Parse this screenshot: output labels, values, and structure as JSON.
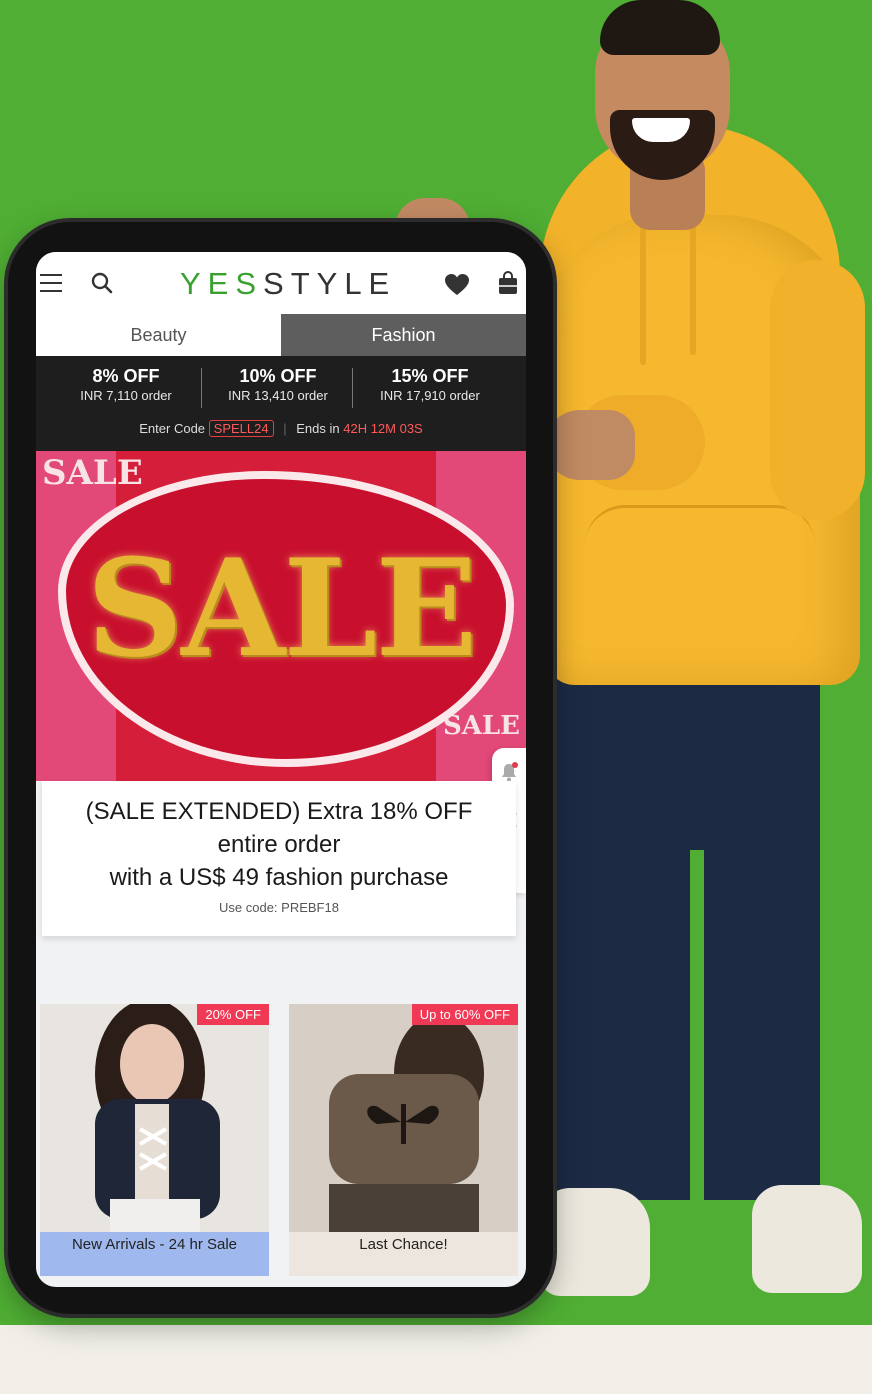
{
  "app": {
    "logo_prefix": "YES",
    "logo_suffix": "STYLE",
    "brand_green": "#3aa12f"
  },
  "header": {
    "icons": [
      "menu-icon",
      "search-icon",
      "heart-icon",
      "shopping-bag-icon"
    ]
  },
  "tabs": [
    {
      "label": "Beauty",
      "active": false
    },
    {
      "label": "Fashion",
      "active": true
    }
  ],
  "promo": {
    "tiers": [
      {
        "discount": "8% OFF",
        "threshold": "INR 7,110 order"
      },
      {
        "discount": "10% OFF",
        "threshold": "INR 13,410 order"
      },
      {
        "discount": "15% OFF",
        "threshold": "INR 17,910 order"
      }
    ],
    "enter_code_label": "Enter Code",
    "code": "SPELL24",
    "ends_label": "Ends in",
    "timer": "42H 12M 03S"
  },
  "banner": {
    "sale_text": "SALE",
    "accent": "#d51f3a"
  },
  "rail": {
    "icons": [
      "bell-icon",
      "share-icon",
      "lightbulb-icon"
    ]
  },
  "card": {
    "line1": "(SALE EXTENDED) Extra 18% OFF",
    "line2": "entire order",
    "line3": "with a US$ 49 fashion purchase",
    "use_code": "Use code: PREBF18"
  },
  "products": [
    {
      "badge": "20% OFF",
      "label": "New Arrivals - 24 hr Sale"
    },
    {
      "badge": "Up to 60% OFF",
      "label": "Last Chance!"
    }
  ]
}
